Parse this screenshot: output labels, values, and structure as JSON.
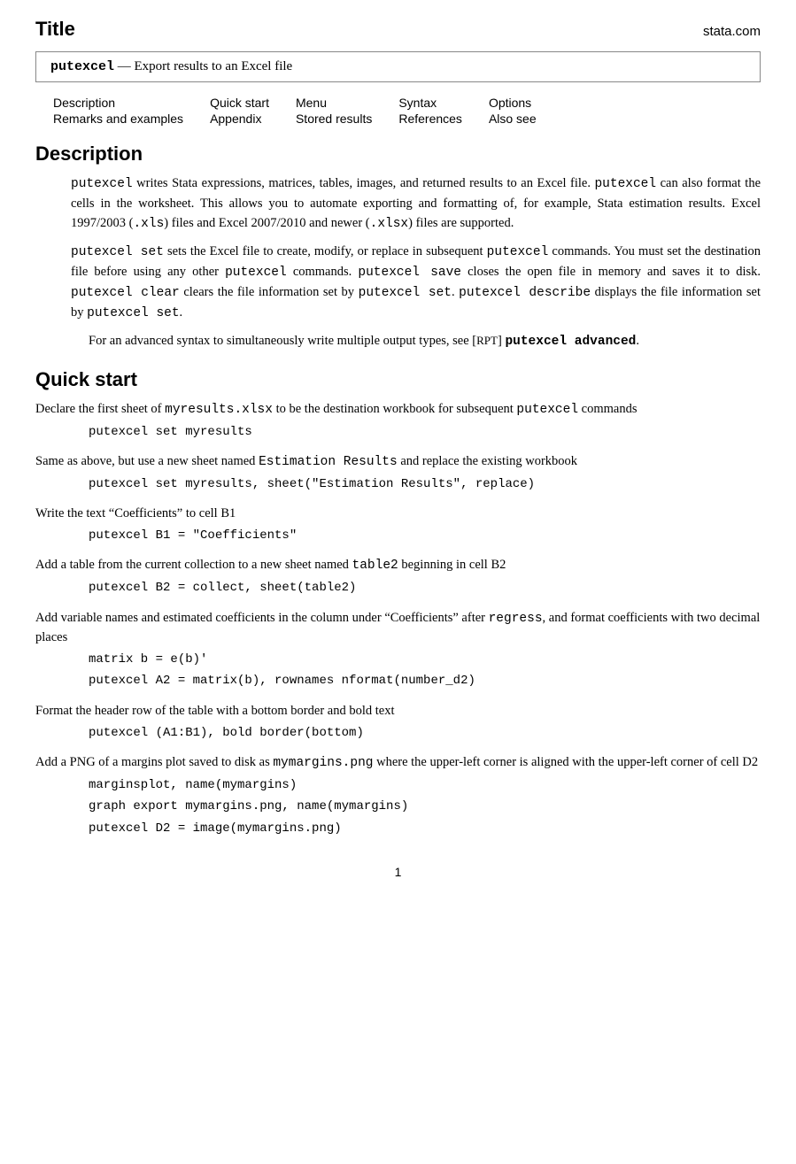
{
  "title": "Title",
  "stata_com": "stata.com",
  "command_box": {
    "command": "putexcel",
    "dash": "—",
    "description": "Export results to an Excel file"
  },
  "nav": {
    "col1_row1": "Description",
    "col1_row2": "Remarks and examples",
    "col2_row1": "Quick start",
    "col2_row2": "Appendix",
    "col3_row1": "Menu",
    "col3_row2": "Stored results",
    "col4_row1": "Syntax",
    "col4_row2": "References",
    "col5_row1": "Options",
    "col5_row2": "Also see"
  },
  "description_heading": "Description",
  "description_para1": "putexcel writes Stata expressions, matrices, tables, images, and returned results to an Excel file. putexcel can also format the cells in the worksheet. This allows you to automate exporting and formatting of, for example, Stata estimation results. Excel 1997/2003 (.xls) files and Excel 2007/2010 and newer (.xlsx) files are supported.",
  "description_para2_pre": "putexcel set sets the Excel file to create, modify, or replace in subsequent putexcel commands. You must set the destination file before using any other putexcel commands. putexcel save closes the open file in memory and saves it to disk. putexcel clear clears the file information set by putexcel set. putexcel describe displays the file information set by putexcel set.",
  "description_para3": "For an advanced syntax to simultaneously write multiple output types, see [RPT] putexcel advanced.",
  "quickstart_heading": "Quick start",
  "qs_items": [
    {
      "desc": "Declare the first sheet of myresults.xlsx to be the destination workbook for subsequent putexcel commands",
      "codes": [
        "putexcel set myresults"
      ]
    },
    {
      "desc": "Same as above, but use a new sheet named Estimation Results and replace the existing workbook",
      "codes": [
        "putexcel set myresults, sheet(\"Estimation Results\", replace)"
      ]
    },
    {
      "desc": "Write the text “Coefficients” to cell B1",
      "codes": [
        "putexcel B1 = \"Coefficients\""
      ]
    },
    {
      "desc": "Add a table from the current collection to a new sheet named table2 beginning in cell B2",
      "codes": [
        "putexcel B2 = collect, sheet(table2)"
      ]
    },
    {
      "desc": "Add variable names and estimated coefficients in the column under “Coefficients” after regress, and format coefficients with two decimal places",
      "codes": [
        "matrix b = e(b)'",
        "putexcel A2 = matrix(b), rownames nformat(number_d2)"
      ]
    },
    {
      "desc": "Format the header row of the table with a bottom border and bold text",
      "codes": [
        "putexcel (A1:B1), bold border(bottom)"
      ]
    },
    {
      "desc": "Add a PNG of a margins plot saved to disk as mymargins.png where the upper-left corner is aligned with the upper-left corner of cell D2",
      "codes": [
        "marginsplot, name(mymargins)",
        "graph export mymargins.png, name(mymargins)",
        "putexcel D2 = image(mymargins.png)"
      ]
    }
  ],
  "page_number": "1"
}
